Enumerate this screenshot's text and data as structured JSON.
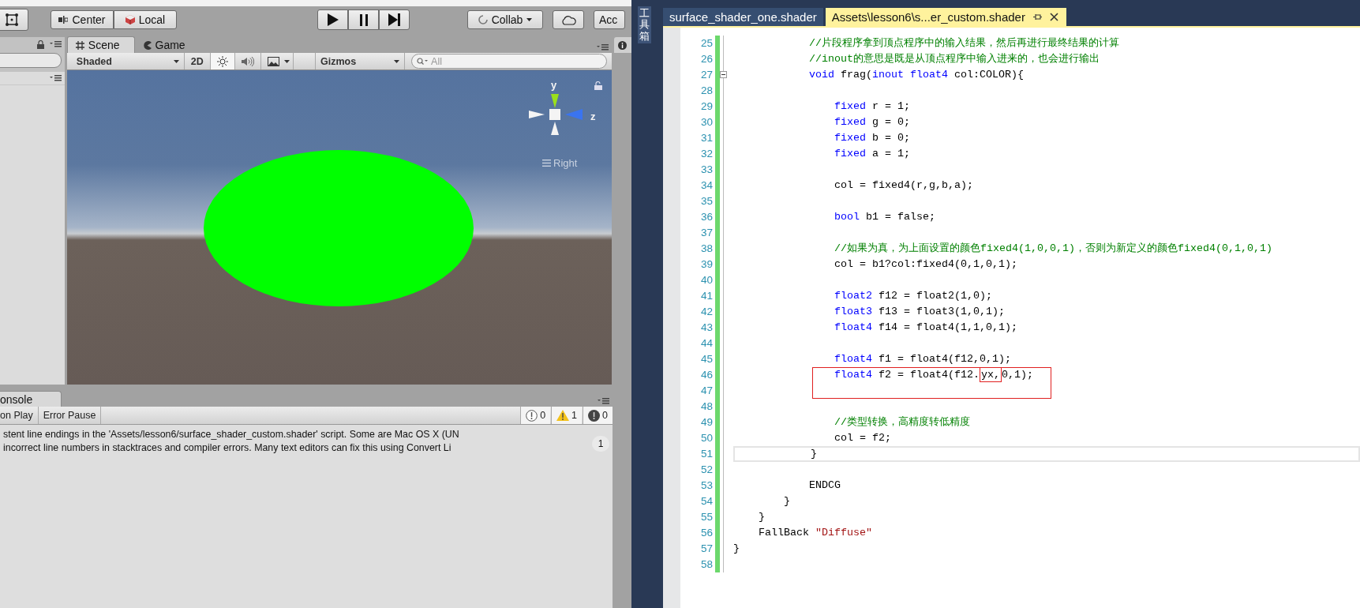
{
  "unity": {
    "toolbar": {
      "pivot_buttons": [
        {
          "label": "Center",
          "kind": "center"
        },
        {
          "label": "Local",
          "kind": "local"
        }
      ],
      "collab": "Collab",
      "account": "Acc"
    },
    "scene": {
      "tabs": [
        {
          "label": "Scene",
          "kind": "scene",
          "selected": true
        },
        {
          "label": "Game",
          "kind": "game",
          "selected": false
        }
      ],
      "shading": "Shaded",
      "mode_2d": "2D",
      "gizmos": "Gizmos",
      "search_placeholder": "All",
      "gizmo": {
        "y_label": "y",
        "z_label": "z",
        "view_label": "Right"
      }
    },
    "console": {
      "tab": "onsole",
      "buttons": [
        "on Play",
        "Error Pause"
      ],
      "counts": [
        {
          "kind": "info",
          "count": "0"
        },
        {
          "kind": "warning",
          "count": "1"
        },
        {
          "kind": "error",
          "count": "0"
        }
      ],
      "message_lines": [
        "stent line endings in the 'Assets/lesson6/surface_shader_custom.shader' script. Some are Mac OS X (UN",
        "incorrect line numbers in stacktraces and compiler errors. Many text editors can fix this using Convert Li"
      ],
      "badge": "1"
    }
  },
  "editor": {
    "toolbox_label": "工具箱",
    "tabs": [
      {
        "label": "surface_shader_one.shader",
        "selected": false
      },
      {
        "label": "Assets\\lesson6\\s...er_custom.shader",
        "selected": true
      }
    ],
    "lines": [
      {
        "n": "25",
        "kind": "code",
        "tokens": [
          {
            "kind": "comment",
            "text": "            //片段程序拿到顶点程序中的输入结果，然后再进行最终结果的计算"
          }
        ]
      },
      {
        "n": "26",
        "kind": "code",
        "tokens": [
          {
            "kind": "comment",
            "text": "            //inout的意思是既是从顶点程序中输入进来的，也会进行输出"
          }
        ]
      },
      {
        "n": "27",
        "kind": "fold_start",
        "tokens": [
          {
            "kind": "keyword",
            "text": "            void"
          },
          {
            "kind": "plain",
            "text": " frag("
          },
          {
            "kind": "keyword",
            "text": "inout"
          },
          {
            "kind": "keyword",
            "text": " float4"
          },
          {
            "kind": "plain",
            "text": " col:COLOR){"
          }
        ]
      },
      {
        "n": "28",
        "kind": "code"
      },
      {
        "n": "29",
        "kind": "code",
        "tokens": [
          {
            "kind": "keyword",
            "text": "                fixed"
          },
          {
            "kind": "plain",
            "text": " r = 1;"
          }
        ]
      },
      {
        "n": "30",
        "kind": "code",
        "tokens": [
          {
            "kind": "keyword",
            "text": "                fixed"
          },
          {
            "kind": "plain",
            "text": " g = 0;"
          }
        ]
      },
      {
        "n": "31",
        "kind": "code",
        "tokens": [
          {
            "kind": "keyword",
            "text": "                fixed"
          },
          {
            "kind": "plain",
            "text": " b = 0;"
          }
        ]
      },
      {
        "n": "32",
        "kind": "code",
        "tokens": [
          {
            "kind": "keyword",
            "text": "                fixed"
          },
          {
            "kind": "plain",
            "text": " a = 1;"
          }
        ]
      },
      {
        "n": "33",
        "kind": "code"
      },
      {
        "n": "34",
        "kind": "code",
        "tokens": [
          {
            "kind": "plain",
            "text": "                col = fixed4(r,g,b,a);"
          }
        ]
      },
      {
        "n": "35",
        "kind": "code"
      },
      {
        "n": "36",
        "kind": "code",
        "tokens": [
          {
            "kind": "keyword",
            "text": "                bool"
          },
          {
            "kind": "plain",
            "text": " b1 = false;"
          }
        ]
      },
      {
        "n": "37",
        "kind": "code"
      },
      {
        "n": "38",
        "kind": "code",
        "tokens": [
          {
            "kind": "comment",
            "text": "                //如果为真，为上面设置的颜色fixed4(1,0,0,1)，否则为新定义的颜色fixed4(0,1,0,1)"
          }
        ]
      },
      {
        "n": "39",
        "kind": "code",
        "tokens": [
          {
            "kind": "plain",
            "text": "                col = b1?col:fixed4(0,1,0,1);"
          }
        ]
      },
      {
        "n": "40",
        "kind": "code"
      },
      {
        "n": "41",
        "kind": "code",
        "tokens": [
          {
            "kind": "keyword",
            "text": "                float2"
          },
          {
            "kind": "plain",
            "text": " f12 = float2(1,0);"
          }
        ]
      },
      {
        "n": "42",
        "kind": "code",
        "tokens": [
          {
            "kind": "keyword",
            "text": "                float3"
          },
          {
            "kind": "plain",
            "text": " f13 = float3(1,0,1);"
          }
        ]
      },
      {
        "n": "43",
        "kind": "code",
        "tokens": [
          {
            "kind": "keyword",
            "text": "                float4"
          },
          {
            "kind": "plain",
            "text": " f14 = float4(1,1,0,1);"
          }
        ]
      },
      {
        "n": "44",
        "kind": "code"
      },
      {
        "n": "45",
        "kind": "code",
        "tokens": [
          {
            "kind": "keyword",
            "text": "                float4"
          },
          {
            "kind": "plain",
            "text": " f1 = float4(f12,0,1);"
          }
        ]
      },
      {
        "kind": "boxed_group",
        "lines": [
          {
            "n": "46",
            "tokens": [
              {
                "kind": "keyword",
                "text": "                float4"
              },
              {
                "kind": "plain",
                "text": " f2 = float4(f12."
              },
              {
                "kind": "marked",
                "text": "yx,"
              },
              {
                "kind": "plain",
                "text": "0,1);"
              }
            ]
          },
          {
            "n": "47"
          }
        ]
      },
      {
        "n": "48",
        "kind": "code"
      },
      {
        "n": "49",
        "kind": "code",
        "tokens": [
          {
            "kind": "comment",
            "text": "                //类型转换，高精度转低精度"
          }
        ]
      },
      {
        "n": "50",
        "kind": "code",
        "tokens": [
          {
            "kind": "plain",
            "text": "                col = f2;"
          }
        ]
      },
      {
        "n": "51",
        "kind": "current",
        "tokens": [
          {
            "kind": "plain",
            "text": "            }"
          }
        ]
      },
      {
        "n": "52",
        "kind": "code"
      },
      {
        "n": "53",
        "kind": "code",
        "tokens": [
          {
            "kind": "plain",
            "text": "            ENDCG"
          }
        ]
      },
      {
        "n": "54",
        "kind": "code",
        "tokens": [
          {
            "kind": "plain",
            "text": "        }"
          }
        ]
      },
      {
        "n": "55",
        "kind": "code",
        "tokens": [
          {
            "kind": "plain",
            "text": "    }"
          }
        ]
      },
      {
        "n": "56",
        "kind": "code",
        "tokens": [
          {
            "kind": "plain",
            "text": "    FallBack "
          },
          {
            "kind": "string",
            "text": "\"Diffuse\""
          }
        ]
      },
      {
        "n": "57",
        "kind": "code",
        "tokens": [
          {
            "kind": "plain",
            "text": "}"
          }
        ]
      },
      {
        "n": "58",
        "kind": "code"
      }
    ]
  }
}
